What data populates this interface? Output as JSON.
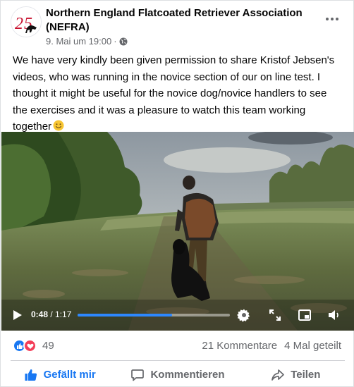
{
  "post": {
    "page_name": "Northern England Flatcoated Retriever Association (NEFRA)",
    "timestamp": "9. Mai um 19:00",
    "separator": "·",
    "avatar_label": "25",
    "text": "We have very kindly been given permission to share Kristof Jebsen's videos, who was running in the novice section of our on line test. I thought it might be useful for the novice dog/novice handlers to see the exercises and it was a pleasure to watch this team working together",
    "emoji_icon": "smiling-face-icon"
  },
  "video": {
    "current_time": "0:48",
    "time_separator": " / ",
    "duration": "1:17",
    "progress_percent": 62,
    "accent_color": "#2d88ff"
  },
  "stats": {
    "reaction_count": "49",
    "comments": "21 Kommentare",
    "shares": "4 Mal geteilt",
    "like_color": "#1877f2",
    "love_color": "#f33e58"
  },
  "actions": {
    "like": "Gefällt mir",
    "comment": "Kommentieren",
    "share": "Teilen"
  }
}
